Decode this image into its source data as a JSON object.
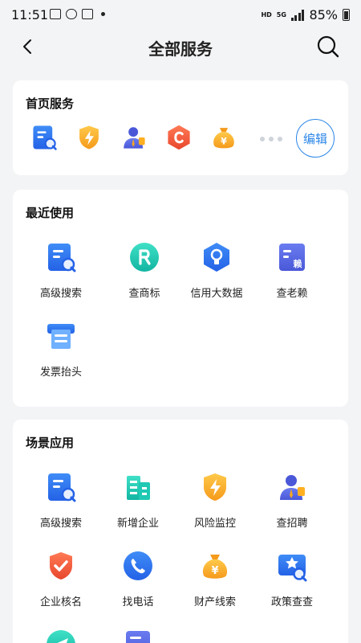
{
  "status_bar": {
    "time": "11:51",
    "network": "HD",
    "signal_type": "5G",
    "battery": "85%"
  },
  "header": {
    "title": "全部服务",
    "back_icon": "chevron-left-icon",
    "search_icon": "search-icon"
  },
  "home_services": {
    "title": "首页服务",
    "icons": [
      "advanced-search-icon",
      "risk-monitor-icon",
      "recruitment-icon",
      "copyright-icon",
      "money-bag-icon"
    ],
    "edit_label": "编辑"
  },
  "recent": {
    "title": "最近使用",
    "items": [
      {
        "label": "高级搜索",
        "icon": "advanced-search-icon"
      },
      {
        "label": "查商标",
        "icon": "trademark-icon"
      },
      {
        "label": "信用大数据",
        "icon": "credit-data-icon"
      },
      {
        "label": "查老赖",
        "icon": "defaulter-icon"
      },
      {
        "label": "发票抬头",
        "icon": "invoice-icon"
      }
    ]
  },
  "scenes": {
    "title": "场景应用",
    "items": [
      {
        "label": "高级搜索",
        "icon": "advanced-search-icon"
      },
      {
        "label": "新增企业",
        "icon": "new-company-icon"
      },
      {
        "label": "风险监控",
        "icon": "risk-monitor-icon"
      },
      {
        "label": "查招聘",
        "icon": "recruitment-icon"
      },
      {
        "label": "企业核名",
        "icon": "name-check-icon"
      },
      {
        "label": "找电话",
        "icon": "phone-icon"
      },
      {
        "label": "财产线索",
        "icon": "property-clue-icon"
      },
      {
        "label": "政策查查",
        "icon": "policy-icon"
      }
    ]
  },
  "colors": {
    "accent": "#2b86e8",
    "blue": "#2f6ff0",
    "orange": "#f5a623",
    "red": "#ef5a3c",
    "teal": "#22c8b4"
  }
}
